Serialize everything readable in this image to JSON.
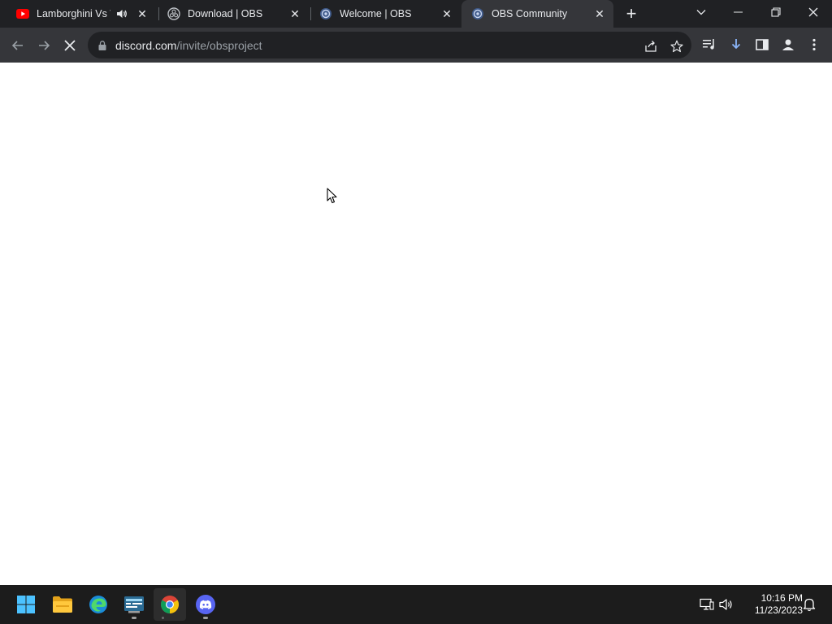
{
  "browser": {
    "tabs": [
      {
        "title": "Lamborghini Vs W",
        "icon": "youtube-icon",
        "audio_icon": "speaker-icon",
        "active": false
      },
      {
        "title": "Download | OBS",
        "icon": "obs-icon",
        "active": false
      },
      {
        "title": "Welcome | OBS",
        "icon": "obs-forum-icon",
        "active": false
      },
      {
        "title": "OBS Community",
        "icon": "obs-forum-icon",
        "active": true
      }
    ],
    "new_tab_symbol": "+",
    "window_controls": [
      "chevron-down-icon",
      "minimize-icon",
      "restore-icon",
      "close-icon"
    ],
    "address_bar": {
      "domain": "discord.com",
      "path": "/invite/obsproject",
      "state": "loading"
    },
    "toolbar_icons": [
      "share-icon",
      "bookmark-star-icon",
      "media-queue-icon",
      "download-icon",
      "side-panel-icon",
      "profile-icon",
      "menu-kebab-icon"
    ]
  },
  "content": {
    "state": "blank-loading"
  },
  "taskbar": {
    "apps": [
      {
        "name": "windows-start-icon"
      },
      {
        "name": "file-explorer-icon"
      },
      {
        "name": "edge-icon"
      },
      {
        "name": "taskbar-app-icon",
        "running": true
      },
      {
        "name": "chrome-icon",
        "running": true,
        "active": true
      },
      {
        "name": "discord-icon",
        "running": true
      }
    ],
    "tray_icons": [
      "network-icon",
      "volume-icon",
      "notification-bell-icon"
    ],
    "clock": {
      "time": "10:16 PM",
      "date": "11/23/2023"
    }
  },
  "colors": {
    "tabstrip_bg": "#202124",
    "toolbar_bg": "#35363a",
    "taskbar_bg": "#1c1c1c",
    "page_bg": "#ffffff",
    "youtube_red": "#ff0000",
    "discord_blurple": "#5865f2"
  }
}
